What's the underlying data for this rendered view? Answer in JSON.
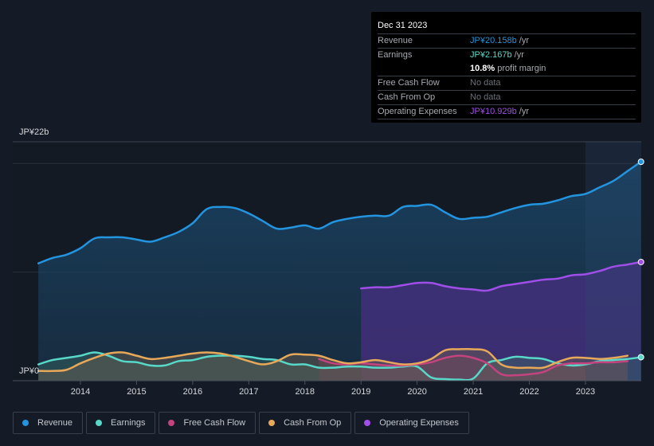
{
  "tooltip": {
    "date": "Dec 31 2023",
    "rows": [
      {
        "label": "Revenue",
        "value": "JP¥20.158b",
        "unit": " /yr",
        "color": "#2394df"
      },
      {
        "label": "Earnings",
        "value": "JP¥2.167b",
        "unit": " /yr",
        "color": "#57d8c8"
      },
      {
        "label": "",
        "value": "10.8%",
        "unit": " profit margin",
        "color": "#ffffff"
      },
      {
        "label": "Free Cash Flow",
        "value": "No data",
        "unit": "",
        "color": "#6c7077"
      },
      {
        "label": "Cash From Op",
        "value": "No data",
        "unit": "",
        "color": "#6c7077"
      },
      {
        "label": "Operating Expenses",
        "value": "JP¥10.929b",
        "unit": " /yr",
        "color": "#a04ee8"
      }
    ]
  },
  "legend": [
    {
      "label": "Revenue",
      "color": "#2394df"
    },
    {
      "label": "Earnings",
      "color": "#57d8c8"
    },
    {
      "label": "Free Cash Flow",
      "color": "#c4437f"
    },
    {
      "label": "Cash From Op",
      "color": "#e8a85a"
    },
    {
      "label": "Operating Expenses",
      "color": "#a04ee8"
    }
  ],
  "chart_data": {
    "type": "area",
    "title": "",
    "xlabel": "",
    "ylabel": "",
    "y_top_label": "JP¥22b",
    "y_bottom_label": "JP¥0",
    "ylim": [
      0,
      22
    ],
    "xlim": [
      2013.25,
      2024.0
    ],
    "x_ticks": [
      2014,
      2015,
      2016,
      2017,
      2018,
      2019,
      2020,
      2021,
      2022,
      2023
    ],
    "x_tick_labels": [
      "2014",
      "2015",
      "2016",
      "2017",
      "2018",
      "2019",
      "2020",
      "2021",
      "2022",
      "2023"
    ],
    "gridlines": [
      10,
      20
    ],
    "highlight_from": 2023.0,
    "unit": "JP¥ billions",
    "series": [
      {
        "name": "Revenue",
        "color": "#2394df",
        "points": [
          [
            2013.25,
            10.8
          ],
          [
            2013.5,
            11.3
          ],
          [
            2013.75,
            11.6
          ],
          [
            2014.0,
            12.2
          ],
          [
            2014.25,
            13.1
          ],
          [
            2014.5,
            13.2
          ],
          [
            2014.75,
            13.2
          ],
          [
            2015.0,
            13.0
          ],
          [
            2015.25,
            12.8
          ],
          [
            2015.5,
            13.2
          ],
          [
            2015.75,
            13.7
          ],
          [
            2016.0,
            14.5
          ],
          [
            2016.25,
            15.8
          ],
          [
            2016.5,
            16.0
          ],
          [
            2016.75,
            15.9
          ],
          [
            2017.0,
            15.4
          ],
          [
            2017.25,
            14.7
          ],
          [
            2017.5,
            14.0
          ],
          [
            2017.75,
            14.1
          ],
          [
            2018.0,
            14.3
          ],
          [
            2018.25,
            14.0
          ],
          [
            2018.5,
            14.6
          ],
          [
            2018.75,
            14.9
          ],
          [
            2019.0,
            15.1
          ],
          [
            2019.25,
            15.2
          ],
          [
            2019.5,
            15.2
          ],
          [
            2019.75,
            16.0
          ],
          [
            2020.0,
            16.1
          ],
          [
            2020.25,
            16.2
          ],
          [
            2020.5,
            15.5
          ],
          [
            2020.75,
            14.9
          ],
          [
            2021.0,
            15.0
          ],
          [
            2021.25,
            15.1
          ],
          [
            2021.5,
            15.5
          ],
          [
            2021.75,
            15.9
          ],
          [
            2022.0,
            16.2
          ],
          [
            2022.25,
            16.3
          ],
          [
            2022.5,
            16.6
          ],
          [
            2022.75,
            17.0
          ],
          [
            2023.0,
            17.2
          ],
          [
            2023.25,
            17.8
          ],
          [
            2023.5,
            18.4
          ],
          [
            2023.75,
            19.3
          ],
          [
            2023.99,
            20.158
          ]
        ]
      },
      {
        "name": "Operating Expenses",
        "color": "#a04ee8",
        "points": [
          [
            2019.0,
            8.5
          ],
          [
            2019.25,
            8.6
          ],
          [
            2019.5,
            8.6
          ],
          [
            2019.75,
            8.8
          ],
          [
            2020.0,
            9.0
          ],
          [
            2020.25,
            9.0
          ],
          [
            2020.5,
            8.7
          ],
          [
            2020.75,
            8.5
          ],
          [
            2021.0,
            8.4
          ],
          [
            2021.25,
            8.3
          ],
          [
            2021.5,
            8.7
          ],
          [
            2021.75,
            8.9
          ],
          [
            2022.0,
            9.1
          ],
          [
            2022.25,
            9.3
          ],
          [
            2022.5,
            9.4
          ],
          [
            2022.75,
            9.7
          ],
          [
            2023.0,
            9.8
          ],
          [
            2023.25,
            10.1
          ],
          [
            2023.5,
            10.5
          ],
          [
            2023.75,
            10.7
          ],
          [
            2023.99,
            10.929
          ]
        ]
      },
      {
        "name": "Earnings",
        "color": "#57d8c8",
        "points": [
          [
            2013.25,
            1.5
          ],
          [
            2013.5,
            1.9
          ],
          [
            2013.75,
            2.1
          ],
          [
            2014.0,
            2.3
          ],
          [
            2014.25,
            2.6
          ],
          [
            2014.5,
            2.3
          ],
          [
            2014.75,
            1.8
          ],
          [
            2015.0,
            1.7
          ],
          [
            2015.25,
            1.4
          ],
          [
            2015.5,
            1.4
          ],
          [
            2015.75,
            1.8
          ],
          [
            2016.0,
            1.9
          ],
          [
            2016.25,
            2.2
          ],
          [
            2016.5,
            2.3
          ],
          [
            2016.75,
            2.3
          ],
          [
            2017.0,
            2.2
          ],
          [
            2017.25,
            2.0
          ],
          [
            2017.5,
            1.9
          ],
          [
            2017.75,
            1.5
          ],
          [
            2018.0,
            1.5
          ],
          [
            2018.25,
            1.2
          ],
          [
            2018.5,
            1.2
          ],
          [
            2018.75,
            1.3
          ],
          [
            2019.0,
            1.3
          ],
          [
            2019.25,
            1.2
          ],
          [
            2019.5,
            1.2
          ],
          [
            2019.75,
            1.3
          ],
          [
            2020.0,
            1.3
          ],
          [
            2020.25,
            0.3
          ],
          [
            2020.5,
            0.15
          ],
          [
            2020.75,
            0.1
          ],
          [
            2021.0,
            0.2
          ],
          [
            2021.25,
            1.6
          ],
          [
            2021.5,
            1.9
          ],
          [
            2021.75,
            2.2
          ],
          [
            2022.0,
            2.1
          ],
          [
            2022.25,
            2.0
          ],
          [
            2022.5,
            1.6
          ],
          [
            2022.75,
            1.4
          ],
          [
            2023.0,
            1.5
          ],
          [
            2023.25,
            1.8
          ],
          [
            2023.5,
            1.9
          ],
          [
            2023.75,
            2.0
          ],
          [
            2023.99,
            2.167
          ]
        ]
      },
      {
        "name": "Free Cash Flow",
        "color": "#c4437f",
        "points": [
          [
            2018.25,
            2.0
          ],
          [
            2018.5,
            1.6
          ],
          [
            2018.75,
            1.5
          ],
          [
            2019.0,
            1.6
          ],
          [
            2019.25,
            1.5
          ],
          [
            2019.5,
            1.4
          ],
          [
            2019.75,
            1.4
          ],
          [
            2020.0,
            1.5
          ],
          [
            2020.25,
            1.7
          ],
          [
            2020.5,
            2.1
          ],
          [
            2020.75,
            2.3
          ],
          [
            2021.0,
            2.1
          ],
          [
            2021.25,
            1.6
          ],
          [
            2021.5,
            0.6
          ],
          [
            2021.75,
            0.5
          ],
          [
            2022.0,
            0.6
          ],
          [
            2022.25,
            0.8
          ],
          [
            2022.5,
            1.4
          ],
          [
            2022.75,
            1.6
          ],
          [
            2022.75,
            1.6
          ],
          [
            2023.0,
            1.6
          ],
          [
            2023.25,
            1.7
          ],
          [
            2023.5,
            1.7
          ],
          [
            2023.75,
            1.8
          ]
        ]
      },
      {
        "name": "Cash From Op",
        "color": "#e8a85a",
        "points": [
          [
            2013.25,
            0.9
          ],
          [
            2013.5,
            0.9
          ],
          [
            2013.75,
            1.0
          ],
          [
            2014.0,
            1.6
          ],
          [
            2014.25,
            2.1
          ],
          [
            2014.5,
            2.5
          ],
          [
            2014.75,
            2.6
          ],
          [
            2015.0,
            2.3
          ],
          [
            2015.25,
            2.0
          ],
          [
            2015.5,
            2.1
          ],
          [
            2015.75,
            2.3
          ],
          [
            2016.0,
            2.5
          ],
          [
            2016.25,
            2.6
          ],
          [
            2016.5,
            2.5
          ],
          [
            2016.75,
            2.2
          ],
          [
            2017.0,
            1.8
          ],
          [
            2017.25,
            1.5
          ],
          [
            2017.5,
            1.8
          ],
          [
            2017.75,
            2.4
          ],
          [
            2018.0,
            2.4
          ],
          [
            2018.25,
            2.3
          ],
          [
            2018.5,
            1.9
          ],
          [
            2018.75,
            1.6
          ],
          [
            2019.0,
            1.7
          ],
          [
            2019.25,
            1.9
          ],
          [
            2019.5,
            1.7
          ],
          [
            2019.75,
            1.5
          ],
          [
            2020.0,
            1.6
          ],
          [
            2020.25,
            2.0
          ],
          [
            2020.5,
            2.8
          ],
          [
            2020.75,
            2.9
          ],
          [
            2021.0,
            2.9
          ],
          [
            2021.25,
            2.7
          ],
          [
            2021.5,
            1.5
          ],
          [
            2021.75,
            1.2
          ],
          [
            2022.0,
            1.2
          ],
          [
            2022.25,
            1.2
          ],
          [
            2022.5,
            1.7
          ],
          [
            2022.75,
            2.1
          ],
          [
            2023.0,
            2.1
          ],
          [
            2023.25,
            2.0
          ],
          [
            2023.5,
            2.1
          ],
          [
            2023.75,
            2.3
          ]
        ]
      }
    ]
  }
}
